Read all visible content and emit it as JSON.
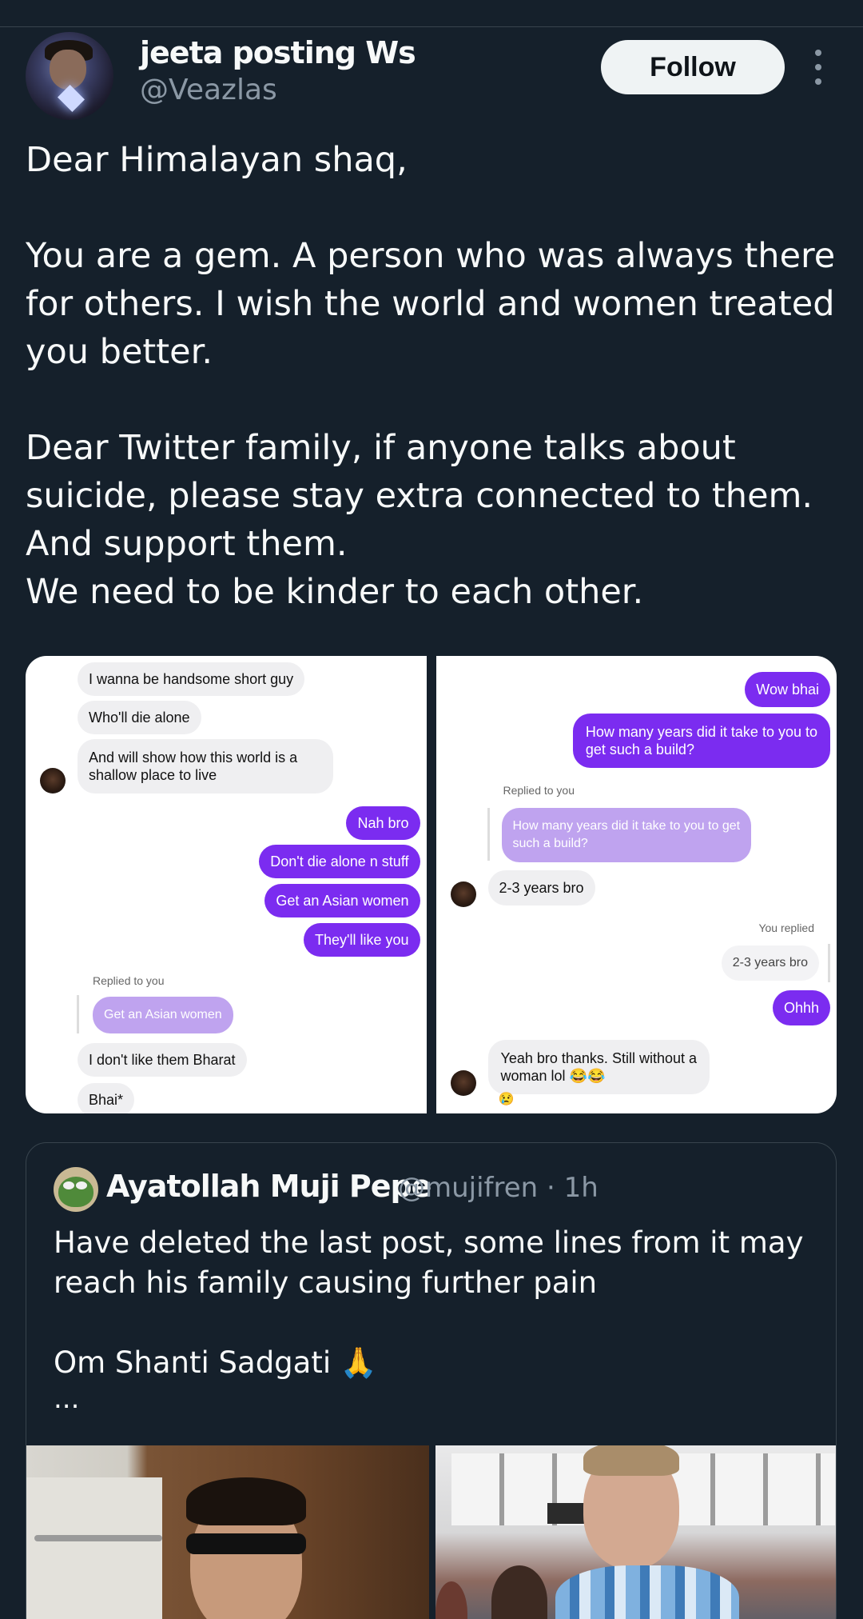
{
  "post": {
    "author_name": "jeeta posting Ws",
    "author_handle": "@Veazlas",
    "follow_label": "Follow",
    "text": "Dear Himalayan shaq,\n\nYou are a gem. A person who was always there for others. I wish the world and women treated you better.\n\nDear Twitter family, if anyone talks about suicide, please stay extra connected to them. And support them.\nWe need to be kinder to each other."
  },
  "media": {
    "left": {
      "in1": "I wanna be handsome short guy",
      "in2": "Who'll die alone",
      "in3a": "And will show how this world is a",
      "in3b": "shallow place to live",
      "out1": "Nah bro",
      "out2": "Don't die alone n stuff",
      "out3": "Get an Asian women",
      "out4": "They'll like you",
      "replied_label": "Replied to you",
      "quoted": "Get an Asian women",
      "in4": "I don't like them Bharat",
      "in5": "Bhai*"
    },
    "right": {
      "out1": "Wow bhai",
      "out2a": "How many years did it take to you to",
      "out2b": "get such a build?",
      "replied_label": "Replied to you",
      "quoted_a": "How many years did it take to you to get",
      "quoted_b": "such a build?",
      "in1": "2-3 years bro",
      "you_replied": "You replied",
      "quoted2": "2-3 years bro",
      "out3": "Ohhh",
      "in2a": "Yeah bro thanks. Still without a",
      "in2b": "woman lol 😂😂",
      "reaction": "😢"
    }
  },
  "quote": {
    "name": "Ayatollah Muji Pepe",
    "meta": "@mujifren · 1h",
    "text": "Have deleted the last post, some lines from it may reach his family causing further pain\n\nOm Shanti Sadgati 🙏",
    "ellipsis": "..."
  }
}
